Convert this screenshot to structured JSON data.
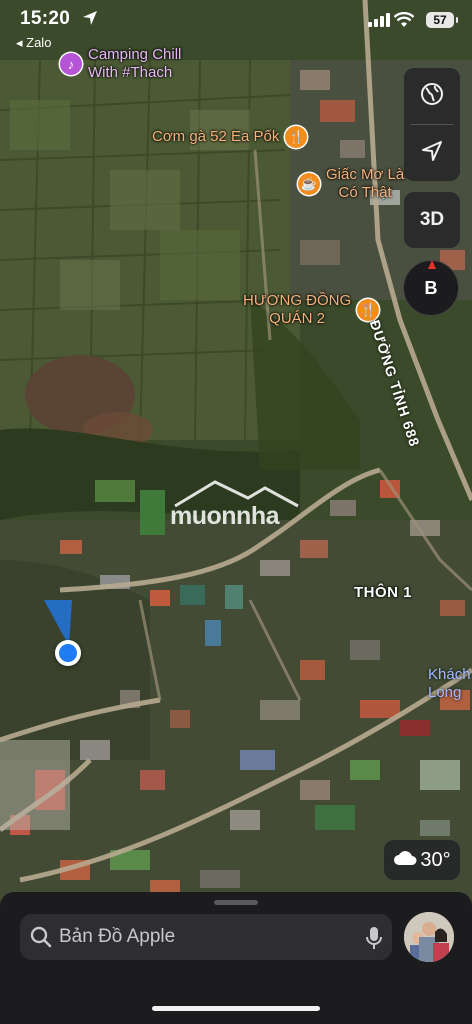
{
  "status": {
    "time": "15:20",
    "back_app": "◂ Zalo",
    "battery": "57"
  },
  "controls": {
    "map_mode_icon": "globe-icon",
    "locate_icon": "location-arrow-icon",
    "view_3d": "3D",
    "compass": "B"
  },
  "pois": [
    {
      "name": "Camping Chill\nWith #Thach",
      "category": "music",
      "icon": "music-note-icon"
    },
    {
      "name": "Cơm gà 52 Ea Pốk",
      "category": "food",
      "icon": "fork-knife-icon"
    },
    {
      "name": "Giấc Mơ Là\nCó Thật",
      "category": "cafe",
      "icon": "coffee-cup-icon"
    },
    {
      "name": "HƯƠNG ĐỒNG\nQUÁN 2",
      "category": "food",
      "icon": "fork-knife-icon"
    },
    {
      "name": "Khách\nLong",
      "category": "hotel",
      "icon": ""
    }
  ],
  "labels": {
    "road": "ĐƯỜNG TỈNH 688",
    "village": "THÔN 1"
  },
  "watermark": "muonnha",
  "weather": {
    "icon": "cloud-icon",
    "temp": "30°"
  },
  "search": {
    "placeholder": "Bản Đồ Apple",
    "mic_icon": "microphone-icon"
  },
  "colors": {
    "poi_food": "#f28c1d",
    "poi_music": "#b654d6",
    "user_location": "#1f7cf5",
    "compass_north": "#e5332a"
  }
}
